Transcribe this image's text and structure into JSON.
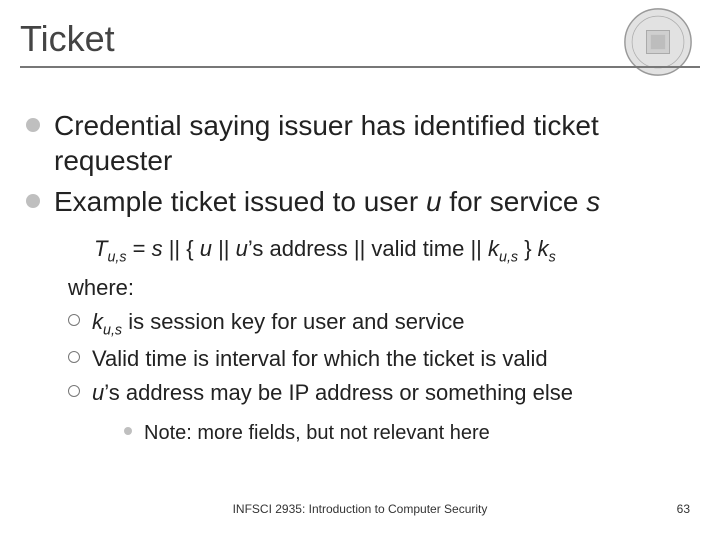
{
  "title": "Ticket",
  "bullets": {
    "b1": "Credential saying issuer has identified ticket requester",
    "b2_pre": "Example ticket issued to user ",
    "b2_u": "u",
    "b2_mid": " for service ",
    "b2_s": "s"
  },
  "formula": {
    "T": "T",
    "sub_us": "u,s",
    "eq": " = ",
    "s": "s",
    "bars_open": " || { ",
    "u": "u",
    "bars": " || ",
    "u2": "u",
    "apos_addr": "’s address || valid time || ",
    "k": "k",
    "close": " } ",
    "k2": "k",
    "sub_s": "s"
  },
  "where": "where:",
  "sub_bullets": {
    "s1_k": "k",
    "s1_sub": "u,s",
    "s1_rest": " is session key for user and service",
    "s2": "Valid time is interval for which the ticket is valid",
    "s3_u": "u",
    "s3_rest": "’s address may be IP address or something else"
  },
  "note": "Note: more fields, but not relevant here",
  "footer": {
    "center": "INFSCI 2935: Introduction to Computer Security",
    "page": "63"
  }
}
